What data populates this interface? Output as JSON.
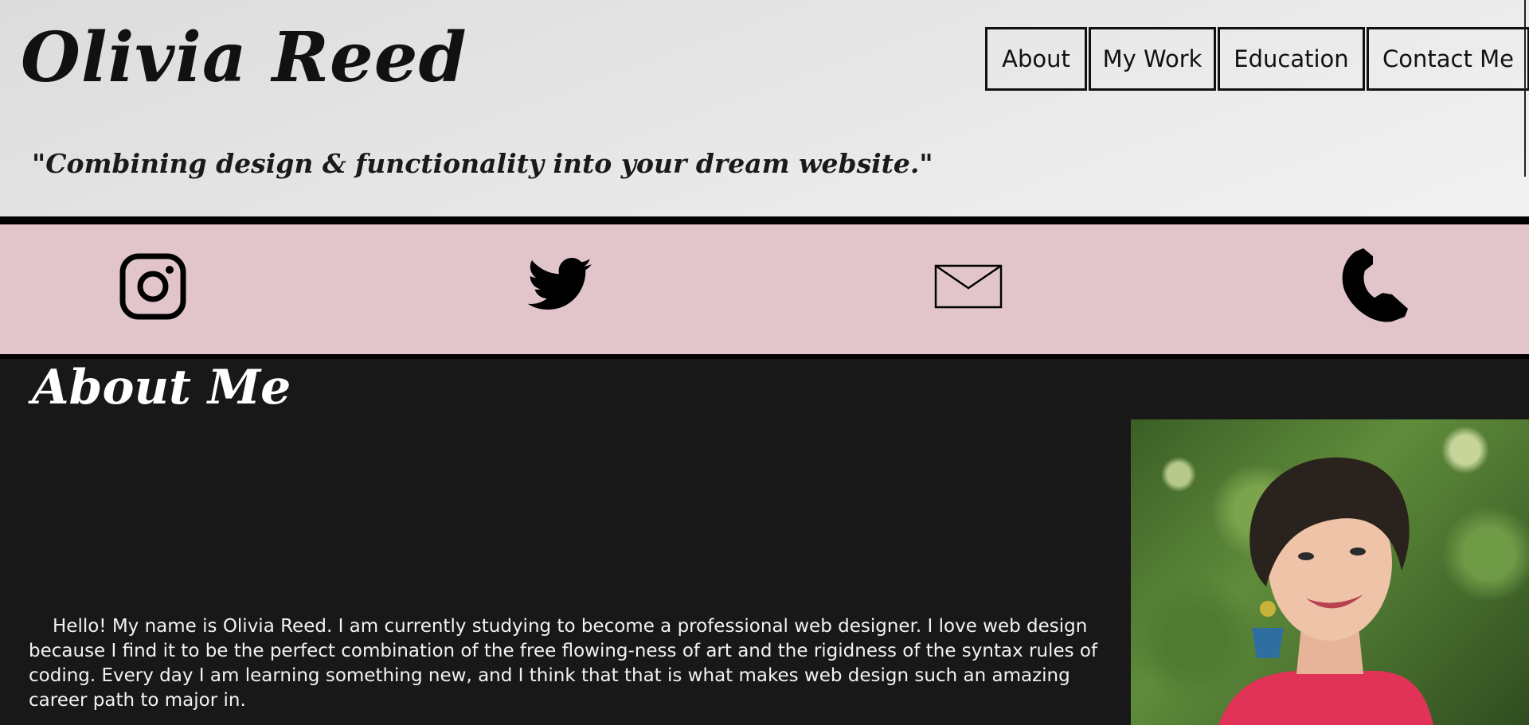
{
  "header": {
    "title": "Olivia Reed",
    "tagline": "\"Combining design & functionality into your dream website.\""
  },
  "nav": {
    "items": [
      {
        "label": "About"
      },
      {
        "label": "My Work"
      },
      {
        "label": "Education"
      },
      {
        "label": "Contact Me"
      }
    ]
  },
  "social": {
    "icons": [
      "instagram-icon",
      "twitter-icon",
      "mail-icon",
      "phone-icon"
    ]
  },
  "about": {
    "heading": "About Me",
    "body": "Hello! My name is Olivia Reed. I am currently studying to become a professional web designer. I love web design because I find it to be the perfect combination of the free flowing-ness of art and the rigidness of the syntax rules of coding. Every day I am learning something new, and I think that that is what makes web design such an amazing career path to major in."
  },
  "colors": {
    "social_band": "#e2c5ca",
    "about_bg": "#181818",
    "header_bg": "#e6e6e6"
  }
}
